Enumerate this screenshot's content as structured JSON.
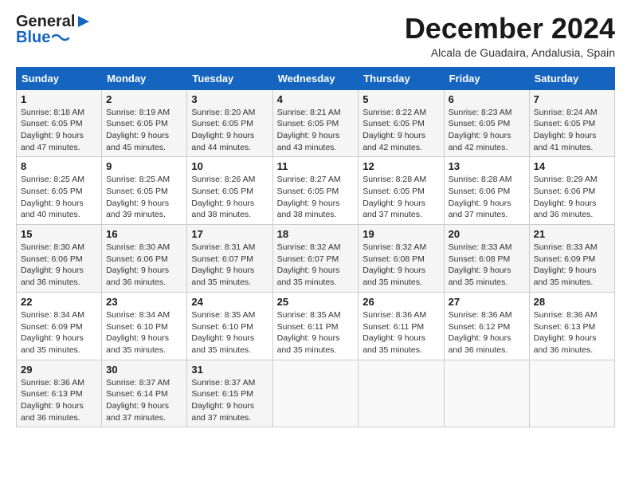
{
  "header": {
    "logo_general": "General",
    "logo_blue": "Blue",
    "month_title": "December 2024",
    "subtitle": "Alcala de Guadaira, Andalusia, Spain"
  },
  "days_of_week": [
    "Sunday",
    "Monday",
    "Tuesday",
    "Wednesday",
    "Thursday",
    "Friday",
    "Saturday"
  ],
  "weeks": [
    [
      {
        "day": "1",
        "sunrise": "Sunrise: 8:18 AM",
        "sunset": "Sunset: 6:05 PM",
        "daylight": "Daylight: 9 hours and 47 minutes."
      },
      {
        "day": "2",
        "sunrise": "Sunrise: 8:19 AM",
        "sunset": "Sunset: 6:05 PM",
        "daylight": "Daylight: 9 hours and 45 minutes."
      },
      {
        "day": "3",
        "sunrise": "Sunrise: 8:20 AM",
        "sunset": "Sunset: 6:05 PM",
        "daylight": "Daylight: 9 hours and 44 minutes."
      },
      {
        "day": "4",
        "sunrise": "Sunrise: 8:21 AM",
        "sunset": "Sunset: 6:05 PM",
        "daylight": "Daylight: 9 hours and 43 minutes."
      },
      {
        "day": "5",
        "sunrise": "Sunrise: 8:22 AM",
        "sunset": "Sunset: 6:05 PM",
        "daylight": "Daylight: 9 hours and 42 minutes."
      },
      {
        "day": "6",
        "sunrise": "Sunrise: 8:23 AM",
        "sunset": "Sunset: 6:05 PM",
        "daylight": "Daylight: 9 hours and 42 minutes."
      },
      {
        "day": "7",
        "sunrise": "Sunrise: 8:24 AM",
        "sunset": "Sunset: 6:05 PM",
        "daylight": "Daylight: 9 hours and 41 minutes."
      }
    ],
    [
      {
        "day": "8",
        "sunrise": "Sunrise: 8:25 AM",
        "sunset": "Sunset: 6:05 PM",
        "daylight": "Daylight: 9 hours and 40 minutes."
      },
      {
        "day": "9",
        "sunrise": "Sunrise: 8:25 AM",
        "sunset": "Sunset: 6:05 PM",
        "daylight": "Daylight: 9 hours and 39 minutes."
      },
      {
        "day": "10",
        "sunrise": "Sunrise: 8:26 AM",
        "sunset": "Sunset: 6:05 PM",
        "daylight": "Daylight: 9 hours and 38 minutes."
      },
      {
        "day": "11",
        "sunrise": "Sunrise: 8:27 AM",
        "sunset": "Sunset: 6:05 PM",
        "daylight": "Daylight: 9 hours and 38 minutes."
      },
      {
        "day": "12",
        "sunrise": "Sunrise: 8:28 AM",
        "sunset": "Sunset: 6:05 PM",
        "daylight": "Daylight: 9 hours and 37 minutes."
      },
      {
        "day": "13",
        "sunrise": "Sunrise: 8:28 AM",
        "sunset": "Sunset: 6:06 PM",
        "daylight": "Daylight: 9 hours and 37 minutes."
      },
      {
        "day": "14",
        "sunrise": "Sunrise: 8:29 AM",
        "sunset": "Sunset: 6:06 PM",
        "daylight": "Daylight: 9 hours and 36 minutes."
      }
    ],
    [
      {
        "day": "15",
        "sunrise": "Sunrise: 8:30 AM",
        "sunset": "Sunset: 6:06 PM",
        "daylight": "Daylight: 9 hours and 36 minutes."
      },
      {
        "day": "16",
        "sunrise": "Sunrise: 8:30 AM",
        "sunset": "Sunset: 6:06 PM",
        "daylight": "Daylight: 9 hours and 36 minutes."
      },
      {
        "day": "17",
        "sunrise": "Sunrise: 8:31 AM",
        "sunset": "Sunset: 6:07 PM",
        "daylight": "Daylight: 9 hours and 35 minutes."
      },
      {
        "day": "18",
        "sunrise": "Sunrise: 8:32 AM",
        "sunset": "Sunset: 6:07 PM",
        "daylight": "Daylight: 9 hours and 35 minutes."
      },
      {
        "day": "19",
        "sunrise": "Sunrise: 8:32 AM",
        "sunset": "Sunset: 6:08 PM",
        "daylight": "Daylight: 9 hours and 35 minutes."
      },
      {
        "day": "20",
        "sunrise": "Sunrise: 8:33 AM",
        "sunset": "Sunset: 6:08 PM",
        "daylight": "Daylight: 9 hours and 35 minutes."
      },
      {
        "day": "21",
        "sunrise": "Sunrise: 8:33 AM",
        "sunset": "Sunset: 6:09 PM",
        "daylight": "Daylight: 9 hours and 35 minutes."
      }
    ],
    [
      {
        "day": "22",
        "sunrise": "Sunrise: 8:34 AM",
        "sunset": "Sunset: 6:09 PM",
        "daylight": "Daylight: 9 hours and 35 minutes."
      },
      {
        "day": "23",
        "sunrise": "Sunrise: 8:34 AM",
        "sunset": "Sunset: 6:10 PM",
        "daylight": "Daylight: 9 hours and 35 minutes."
      },
      {
        "day": "24",
        "sunrise": "Sunrise: 8:35 AM",
        "sunset": "Sunset: 6:10 PM",
        "daylight": "Daylight: 9 hours and 35 minutes."
      },
      {
        "day": "25",
        "sunrise": "Sunrise: 8:35 AM",
        "sunset": "Sunset: 6:11 PM",
        "daylight": "Daylight: 9 hours and 35 minutes."
      },
      {
        "day": "26",
        "sunrise": "Sunrise: 8:36 AM",
        "sunset": "Sunset: 6:11 PM",
        "daylight": "Daylight: 9 hours and 35 minutes."
      },
      {
        "day": "27",
        "sunrise": "Sunrise: 8:36 AM",
        "sunset": "Sunset: 6:12 PM",
        "daylight": "Daylight: 9 hours and 36 minutes."
      },
      {
        "day": "28",
        "sunrise": "Sunrise: 8:36 AM",
        "sunset": "Sunset: 6:13 PM",
        "daylight": "Daylight: 9 hours and 36 minutes."
      }
    ],
    [
      {
        "day": "29",
        "sunrise": "Sunrise: 8:36 AM",
        "sunset": "Sunset: 6:13 PM",
        "daylight": "Daylight: 9 hours and 36 minutes."
      },
      {
        "day": "30",
        "sunrise": "Sunrise: 8:37 AM",
        "sunset": "Sunset: 6:14 PM",
        "daylight": "Daylight: 9 hours and 37 minutes."
      },
      {
        "day": "31",
        "sunrise": "Sunrise: 8:37 AM",
        "sunset": "Sunset: 6:15 PM",
        "daylight": "Daylight: 9 hours and 37 minutes."
      },
      null,
      null,
      null,
      null
    ]
  ]
}
